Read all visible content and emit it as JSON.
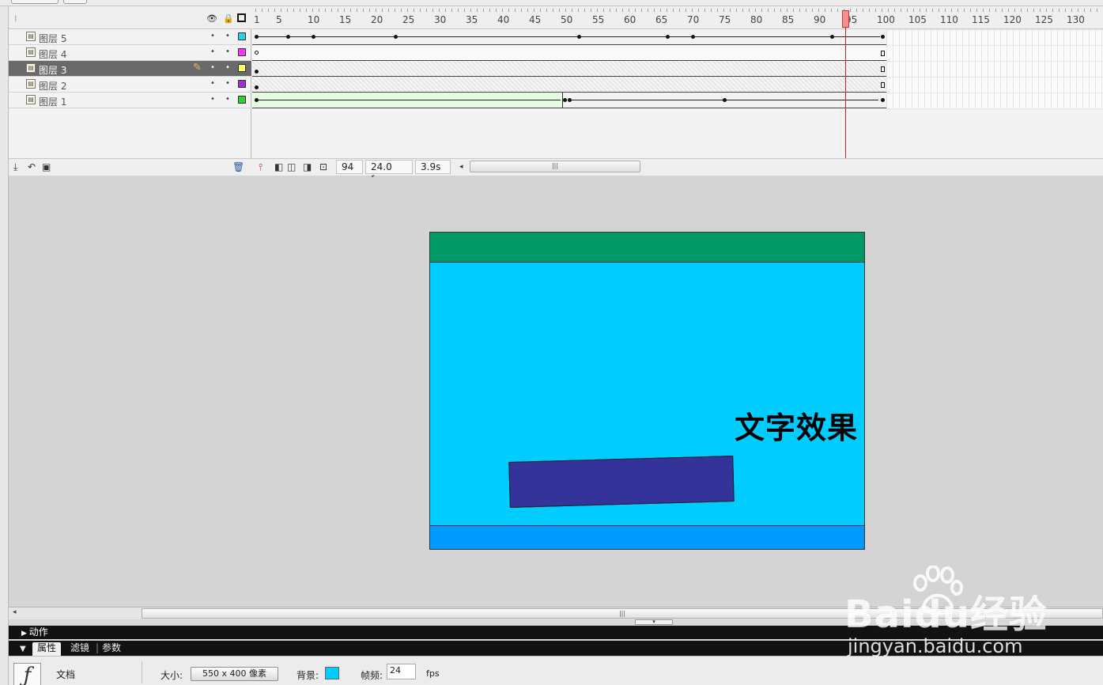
{
  "timeline": {
    "header_icons": {
      "eye": "eye-icon",
      "lock": "lock-icon",
      "outline": "outline-icon"
    },
    "ruler_labels": [
      "1",
      "5",
      "10",
      "15",
      "20",
      "25",
      "30",
      "35",
      "40",
      "45",
      "50",
      "55",
      "60",
      "65",
      "70",
      "75",
      "80",
      "85",
      "90",
      "95",
      "100",
      "105",
      "110",
      "115",
      "120",
      "125",
      "130"
    ],
    "layers": [
      {
        "name": "图层 5",
        "color": "#33ccdd",
        "selected": false
      },
      {
        "name": "图层 4",
        "color": "#ff33ff",
        "selected": false
      },
      {
        "name": "图层 3",
        "color": "#ffff66",
        "selected": true
      },
      {
        "name": "图层 2",
        "color": "#9933cc",
        "selected": false
      },
      {
        "name": "图层 1",
        "color": "#33cc33",
        "selected": false
      }
    ],
    "current_frame": "94",
    "fps": "24.0 fps",
    "elapsed": "3.9s",
    "total_frames": 100
  },
  "stage": {
    "text": "文字效果",
    "colors": {
      "background": "#00ccff",
      "top_bar": "#009966",
      "bottom_bar": "#0099ff",
      "rectangle": "#333399"
    }
  },
  "panels": {
    "actions_label": "动作",
    "tabs": [
      "属性",
      "滤镜",
      "参数"
    ],
    "doc_label": "文档",
    "size_label": "大小:",
    "size_value": "550 x 400 像素",
    "bg_label": "背景:",
    "frame_rate_label": "帧频:",
    "frame_rate_value": "24",
    "fps_unit": "fps"
  },
  "watermark": {
    "brand": "Baidu经验",
    "url": "jingyan.baidu.com"
  }
}
